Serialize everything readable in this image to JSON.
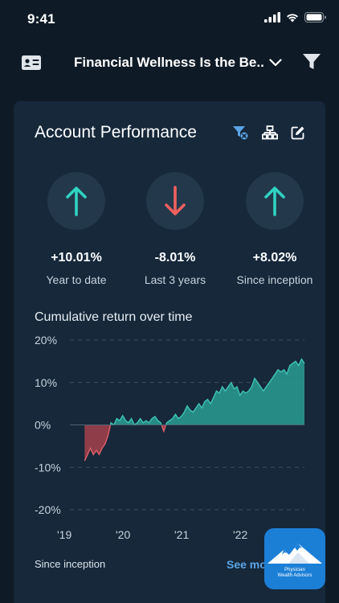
{
  "status_bar": {
    "time": "9:41"
  },
  "nav": {
    "title": "Financial Wellness Is the Be..",
    "left_icon": "contact-card-icon",
    "right_icon": "filter-icon",
    "dropdown_icon": "chevron-down-icon"
  },
  "card": {
    "title": "Account Performance",
    "tools": [
      "filter-clear-icon",
      "hierarchy-icon",
      "edit-icon"
    ]
  },
  "metrics": [
    {
      "value": "+10.01%",
      "label": "Year to date",
      "direction": "up",
      "color": "#2fd3c2"
    },
    {
      "value": "-8.01%",
      "label": "Last 3 years",
      "direction": "down",
      "color": "#f0605e"
    },
    {
      "value": "+8.02%",
      "label": "Since inception",
      "direction": "up",
      "color": "#2fd3c2"
    }
  ],
  "chart": {
    "title": "Cumulative return over time",
    "footer_left": "Since inception",
    "footer_right": "See more"
  },
  "logo": {
    "line1": "Physician",
    "line2": "Wealth Advisors"
  },
  "colors": {
    "positive": "#2a9c93",
    "negative": "#b8444f",
    "background": "#0e1b27",
    "card": "#16283a",
    "accent": "#5ba4e6"
  },
  "chart_data": {
    "type": "area",
    "ylim": [
      -20,
      20
    ],
    "y_ticks": [
      "20%",
      "10%",
      "0%",
      "-10%",
      "-20%"
    ],
    "y_tick_values": [
      20,
      10,
      0,
      -10,
      -20
    ],
    "x_ticks": [
      "'19",
      "'20",
      "'21",
      "'22"
    ],
    "x_tick_values": [
      2019,
      2020,
      2021,
      2022
    ],
    "grid": true,
    "series": [
      {
        "x": [
          2019.25,
          2019.3,
          2019.35,
          2019.4,
          2019.45,
          2019.5,
          2019.55,
          2019.6,
          2019.65,
          2019.7,
          2019.75,
          2019.8,
          2019.85,
          2019.9,
          2019.95,
          2020.0,
          2020.05,
          2020.1,
          2020.15,
          2020.2,
          2020.25,
          2020.3,
          2020.35,
          2020.4,
          2020.45,
          2020.5,
          2020.55,
          2020.6,
          2020.65,
          2020.7,
          2020.75,
          2020.8,
          2020.85,
          2020.9,
          2020.95,
          2021.0,
          2021.05,
          2021.1,
          2021.15,
          2021.2,
          2021.25,
          2021.3,
          2021.35,
          2021.4,
          2021.45,
          2021.5,
          2021.55,
          2021.6,
          2021.65,
          2021.7,
          2021.75,
          2021.8,
          2021.85,
          2021.9,
          2021.95,
          2022.0,
          2022.05,
          2022.1,
          2022.15,
          2022.2,
          2022.25,
          2022.3,
          2022.35,
          2022.4,
          2022.45,
          2022.5,
          2022.55,
          2022.6,
          2022.65,
          2022.7,
          2022.75,
          2022.8,
          2022.85,
          2022.9,
          2022.95,
          2023.0
        ],
        "y": [
          -8.5,
          -7,
          -5.5,
          -7,
          -6,
          -7,
          -5.5,
          -4.5,
          -2.5,
          0.5,
          0,
          1.5,
          1,
          2.2,
          1,
          0.5,
          1.5,
          0,
          0.5,
          1.5,
          0.5,
          1,
          0.5,
          1.5,
          2,
          1,
          0.5,
          -1.5,
          0.5,
          1,
          1.5,
          2.5,
          1.5,
          2,
          3,
          4.5,
          3.5,
          3,
          4,
          5,
          4,
          5.5,
          6,
          5,
          6.5,
          8,
          7.5,
          9,
          8,
          9,
          10,
          8.5,
          9,
          7,
          8,
          7.5,
          8,
          9,
          11,
          10,
          9,
          8,
          9,
          10,
          11,
          12,
          13,
          12.5,
          13,
          12,
          14,
          14.5,
          15,
          14,
          15.5,
          14.5
        ],
        "color": "#2a9c93"
      }
    ]
  }
}
